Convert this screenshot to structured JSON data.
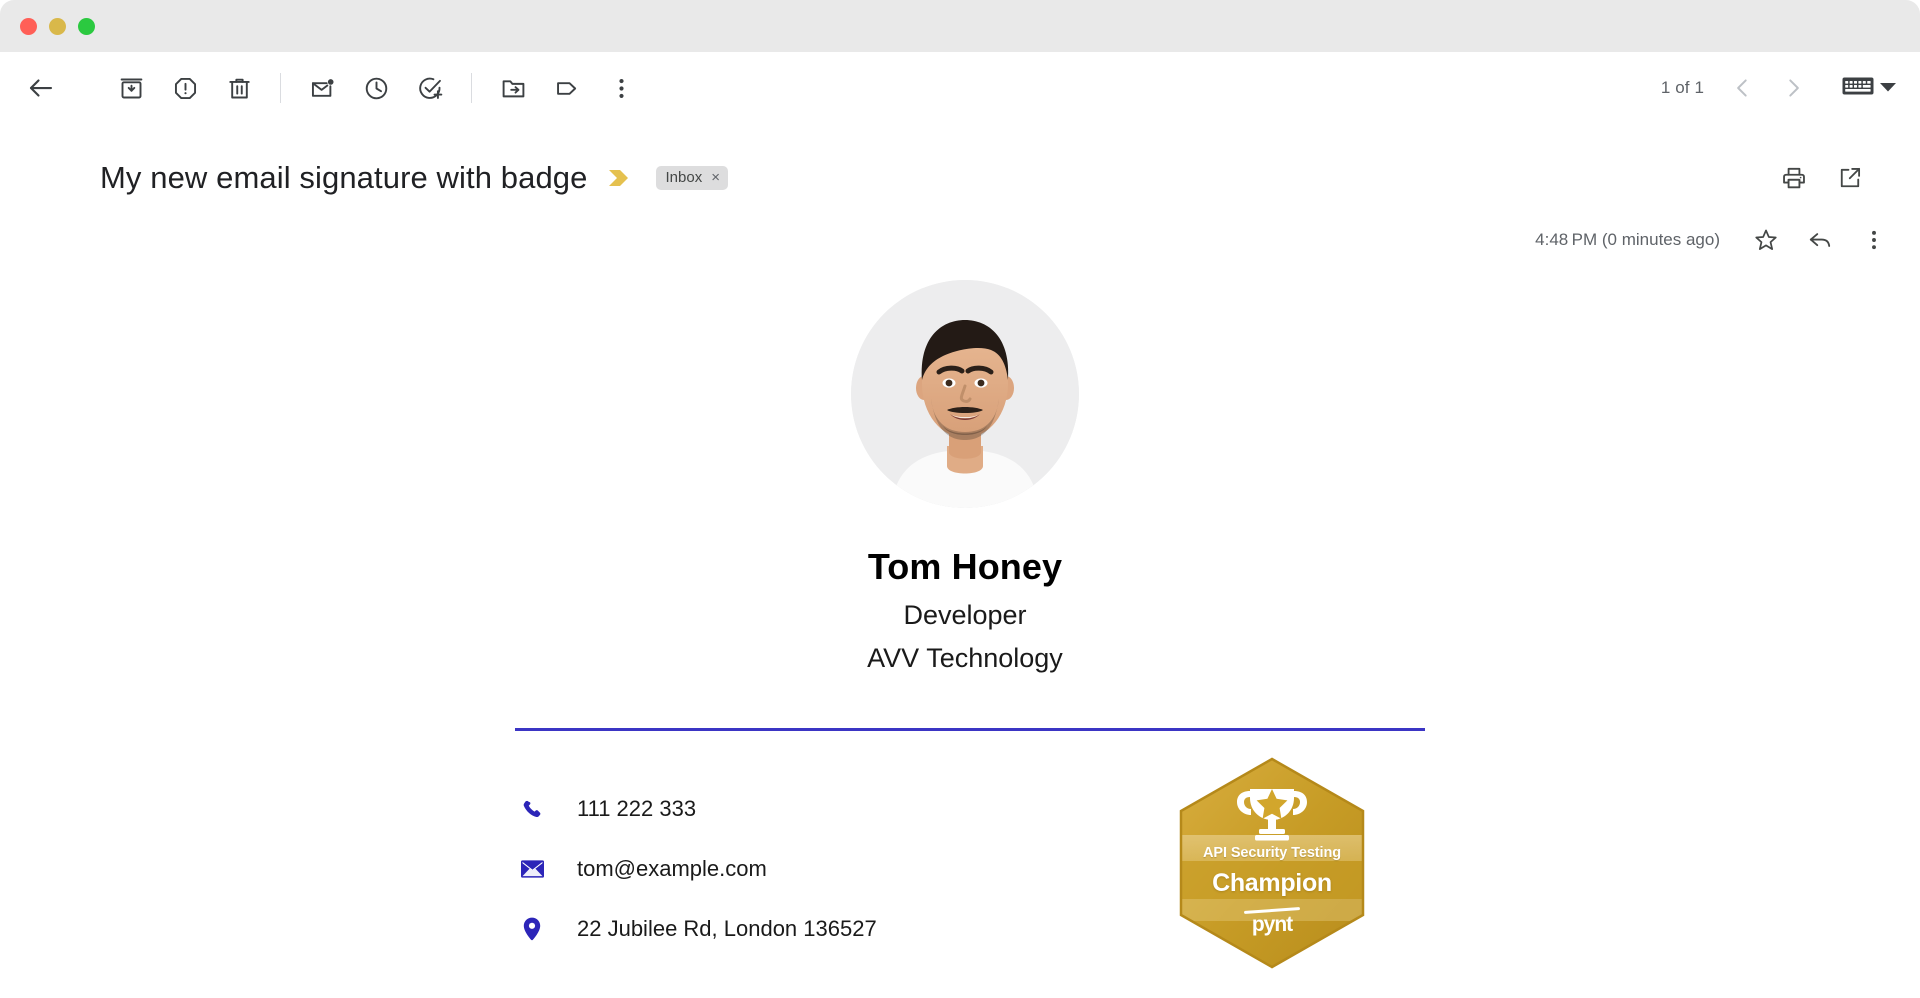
{
  "window": {
    "traffic_lights": [
      {
        "name": "close",
        "color": "#ff5f57"
      },
      {
        "name": "minimize",
        "color": "#d9b84a"
      },
      {
        "name": "zoom",
        "color": "#2bc940"
      }
    ]
  },
  "toolbar": {
    "icons": [
      {
        "name": "back-icon",
        "label": "Back to Inbox"
      },
      {
        "name": "archive-icon",
        "label": "Archive"
      },
      {
        "name": "report-spam-icon",
        "label": "Report spam"
      },
      {
        "name": "delete-icon",
        "label": "Delete"
      },
      {
        "name": "mark-unread-icon",
        "label": "Mark as unread"
      },
      {
        "name": "snooze-icon",
        "label": "Snooze"
      },
      {
        "name": "add-to-tasks-icon",
        "label": "Add to tasks"
      },
      {
        "name": "move-to-icon",
        "label": "Move to"
      },
      {
        "name": "labels-icon",
        "label": "Labels"
      },
      {
        "name": "more-icon",
        "label": "More"
      }
    ],
    "pager": {
      "count": "1 of 1",
      "prev_label": "Older",
      "next_label": "Newer",
      "keyboard_label": "Input tools",
      "dropdown_label": "Select input tool"
    }
  },
  "message": {
    "subject": "My new email signature with badge",
    "important_marker_label": "Important",
    "label_chip": {
      "text": "Inbox",
      "remove": "×"
    },
    "actions": [
      {
        "name": "print-icon",
        "label": "Print all"
      },
      {
        "name": "open-in-new-window-icon",
        "label": "Open in new window"
      }
    ],
    "timestamp": "4:48 PM (0 minutes ago)",
    "meta_actions": [
      {
        "name": "star-icon",
        "label": "Star"
      },
      {
        "name": "reply-icon",
        "label": "Reply"
      },
      {
        "name": "more-vert-icon",
        "label": "More"
      }
    ]
  },
  "signature": {
    "avatar_alt": "Portrait photo of Tom Honey",
    "name": "Tom Honey",
    "role": "Developer",
    "company": "AVV Technology",
    "divider_color": "#3b35c4",
    "accent_color": "#2c25b8",
    "contacts": [
      {
        "icon": "phone-icon",
        "value": "111 222 333"
      },
      {
        "icon": "email-icon",
        "value": "tom@example.com"
      },
      {
        "icon": "location-icon",
        "value": "22 Jubilee Rd, London 136527"
      }
    ],
    "badge": {
      "icon": "trophy-icon",
      "line1": "API Security Testing",
      "line2": "Champion",
      "brand": "pynt",
      "color_light": "#e0c163",
      "color_dark": "#c69b22"
    }
  }
}
